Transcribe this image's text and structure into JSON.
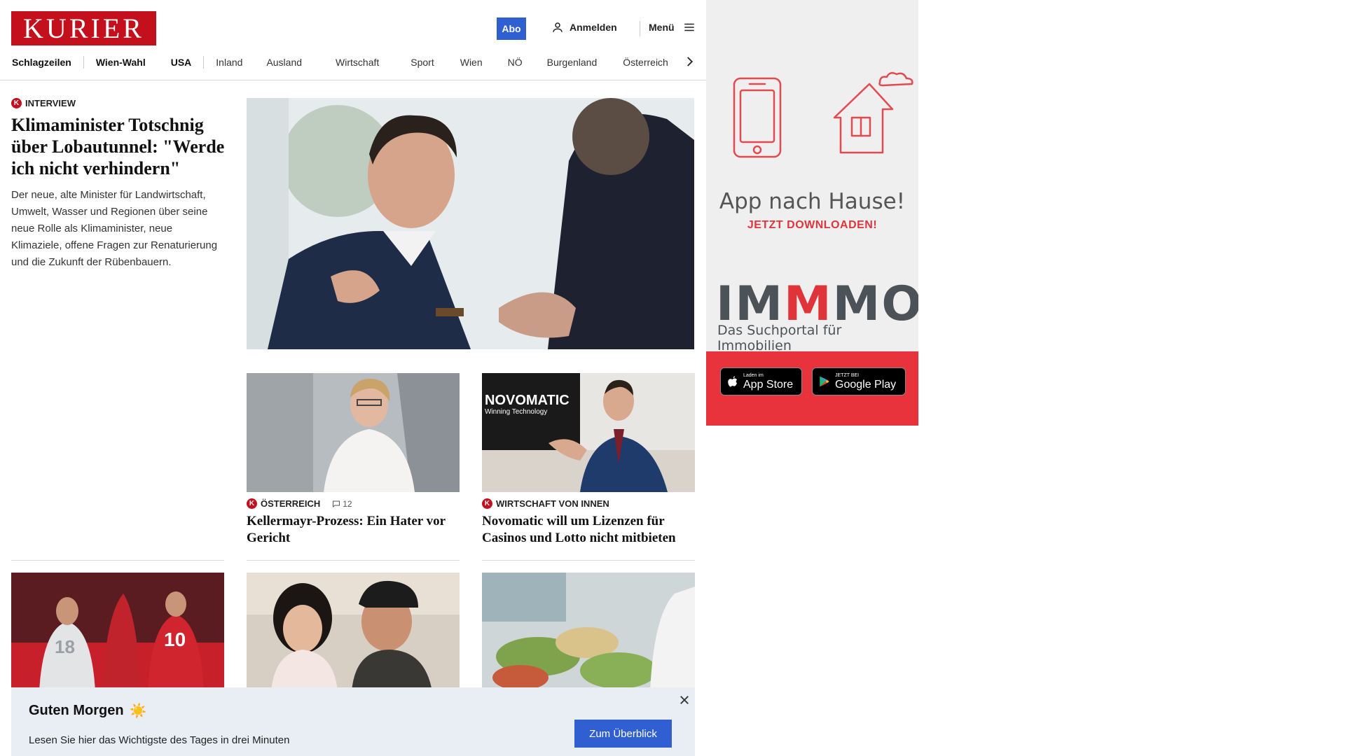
{
  "header": {
    "logo": "KURIER",
    "abo_label": "Abo",
    "login_label": "Anmelden",
    "menu_label": "Menü"
  },
  "nav": {
    "items": [
      "Schlagzeilen",
      "Wien-Wahl",
      "USA",
      "Inland",
      "Ausland",
      "Wirtschaft",
      "Sport",
      "Wien",
      "NÖ",
      "Burgenland",
      "Österreich"
    ]
  },
  "lead": {
    "badge": "K",
    "kicker": "INTERVIEW",
    "title": "Klimaminister Totschnig über Lobautunnel: \"Werde ich nicht verhindern\"",
    "teaser": "Der neue, alte Minister für Landwirtschaft, Umwelt, Wasser und Regionen über seine neue Rolle als Klimaminister, neue Klimaziele, offene Fragen zur Renaturierung und die Zukunft der Rübenbauern."
  },
  "cards": [
    {
      "badge": "K",
      "kicker": "ÖSTERREICH",
      "comments": "12",
      "title": "Kellermayr-Prozess: Ein Hater vor Gericht"
    },
    {
      "badge": "K",
      "kicker": "WIRTSCHAFT VON INNEN",
      "title": "Novomatic will um Lizenzen für Casinos und Lotto nicht mitbieten",
      "image_text": "NOVOMATIC",
      "image_subtext": "Winning Technology"
    }
  ],
  "bottom_cards": [
    {
      "jersey": "18",
      "jersey2": "10"
    },
    {},
    {}
  ],
  "ad": {
    "title": "App nach Hause!",
    "subtitle": "JETZT DOWNLOADEN!",
    "brand_i": "I",
    "brand_m1": "M",
    "brand_m2": "M",
    "brand_m3": "M",
    "brand_o": "O",
    "brand_sub": "Das Suchportal für Immobilien",
    "appstore_small": "Laden im",
    "appstore_big": "App Store",
    "googleplay_small": "JETZT BEI",
    "googleplay_big": "Google Play"
  },
  "popup": {
    "title": "Guten Morgen",
    "emoji": "☀️",
    "text": "Lesen Sie hier das Wichtigste des Tages in drei Minuten",
    "button": "Zum Überblick"
  },
  "colors": {
    "brand_red": "#c4101c",
    "accent_blue": "#2f5fd0",
    "ad_red": "#e9333c"
  }
}
